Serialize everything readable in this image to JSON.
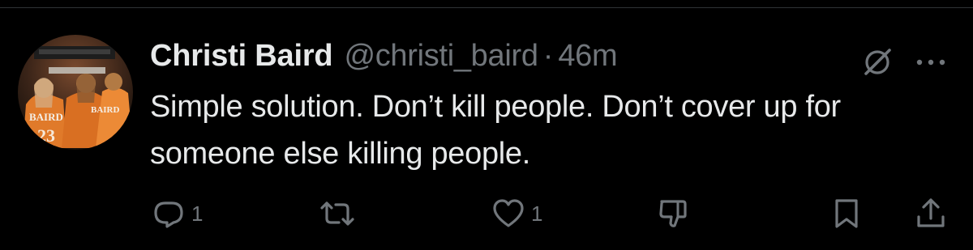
{
  "tweet": {
    "display_name": "Christi Baird",
    "handle": "@christi_baird",
    "separator": "·",
    "time": "46m",
    "text": "Simple solution. Don’t kill people. Don’t cover up for someone else killing people.",
    "avatar_lettering": [
      "BAIRD",
      "BAIRD"
    ]
  },
  "actions": {
    "reply": {
      "icon": "reply-icon",
      "count": "1"
    },
    "retweet": {
      "icon": "retweet-icon",
      "count": ""
    },
    "like": {
      "icon": "heart-icon",
      "count": "1"
    },
    "dislike": {
      "icon": "thumbs-down-icon",
      "count": ""
    },
    "bookmark": {
      "icon": "bookmark-icon"
    },
    "share": {
      "icon": "share-icon"
    }
  },
  "header_icons": [
    "grok-icon",
    "more-icon"
  ],
  "colors": {
    "background": "#000000",
    "primary_text": "#e7e9ea",
    "secondary_text": "#71767b",
    "divider": "#2f3336"
  }
}
